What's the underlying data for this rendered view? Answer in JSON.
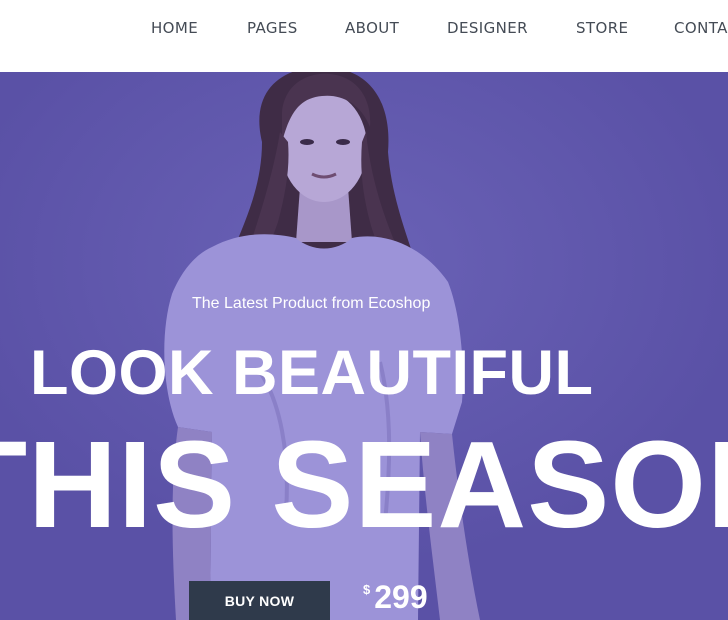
{
  "nav": {
    "items": [
      {
        "label": "HOME"
      },
      {
        "label": "PAGES"
      },
      {
        "label": "ABOUT"
      },
      {
        "label": "DESIGNER"
      },
      {
        "label": "STORE"
      },
      {
        "label": "CONTACT"
      }
    ]
  },
  "hero": {
    "subtitle": "The Latest Product from Ecoshop",
    "headline_line1": "LOOK BEAUTIFUL",
    "headline_line2": "THIS SEASON",
    "cta_label": "BUY NOW",
    "price_currency": "$",
    "price_value": "299",
    "background_color": "#5a51a6",
    "button_color": "#2f3a4b"
  }
}
